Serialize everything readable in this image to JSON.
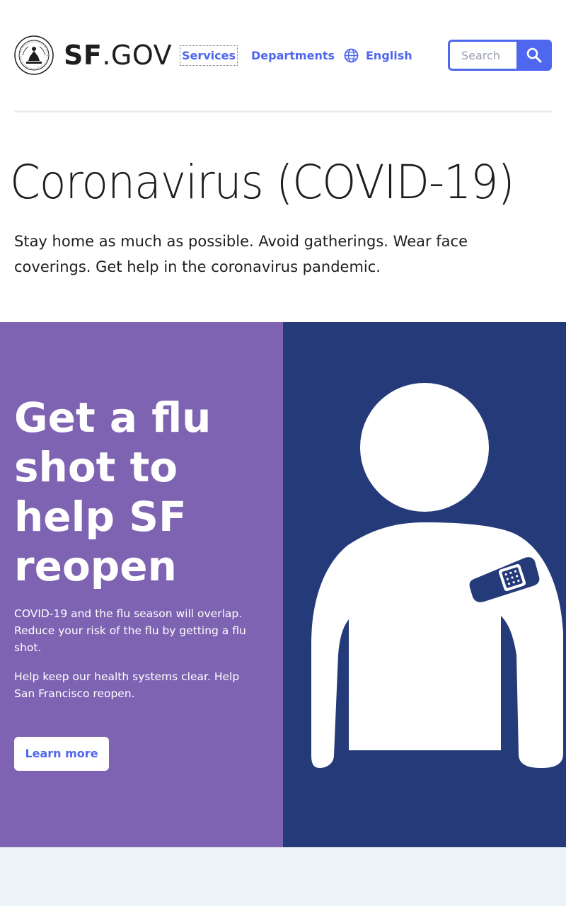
{
  "header": {
    "logo": {
      "icon": "city-seal-icon",
      "brand_bold": "SF",
      "brand_rest": ".GOV"
    },
    "nav": {
      "services": "Services",
      "departments": "Departments",
      "language": {
        "label": "English",
        "icon": "globe-icon"
      }
    },
    "search": {
      "placeholder": "Search",
      "button_icon": "search-icon"
    }
  },
  "main": {
    "title": "Coronavirus (COVID-19)",
    "lede": "Stay home as much as possible. Avoid gatherings. Wear face coverings. Get help in the coronavirus pandemic."
  },
  "hero": {
    "heading": "Get a flu shot to help SF reopen",
    "paragraph_1": "COVID-19 and the flu season will overlap. Reduce your risk of the flu by getting a flu shot.",
    "paragraph_2": "Help keep our health systems clear. Help San Francisco reopen.",
    "button": "Learn more",
    "illustration": "person-with-bandage-icon"
  },
  "colors": {
    "accent": "#4f66ee",
    "hero_left_bg": "#7e63b2",
    "hero_right_bg": "#253a79",
    "footer_band_bg": "#edf4f7",
    "text": "#1e1e1e"
  }
}
